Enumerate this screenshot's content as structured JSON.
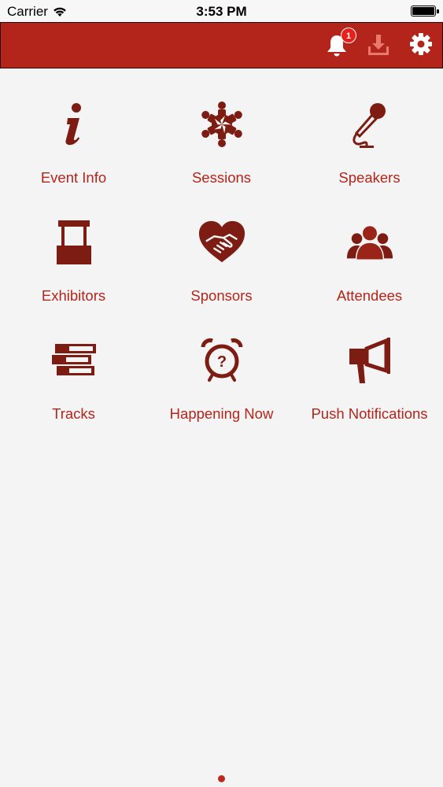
{
  "status_bar": {
    "carrier": "Carrier",
    "time": "3:53 PM"
  },
  "navbar": {
    "background": "#b3251b",
    "notification_count": "1",
    "icons": [
      "bell-icon",
      "download-icon",
      "gear-icon"
    ]
  },
  "menu": {
    "items": [
      {
        "label": "Event Info",
        "icon": "info-icon"
      },
      {
        "label": "Sessions",
        "icon": "people-circle-icon"
      },
      {
        "label": "Speakers",
        "icon": "microphone-icon"
      },
      {
        "label": "Exhibitors",
        "icon": "booth-icon"
      },
      {
        "label": "Sponsors",
        "icon": "heart-handshake-icon"
      },
      {
        "label": "Attendees",
        "icon": "group-icon"
      },
      {
        "label": "Tracks",
        "icon": "tracks-icon"
      },
      {
        "label": "Happening Now",
        "icon": "alarm-clock-icon"
      },
      {
        "label": "Push Notifications",
        "icon": "megaphone-icon"
      }
    ]
  },
  "pager": {
    "pages": 1,
    "current": 1
  },
  "colors": {
    "accent": "#b3251b",
    "icon": "#7d1c12",
    "background": "#f4f4f4"
  }
}
